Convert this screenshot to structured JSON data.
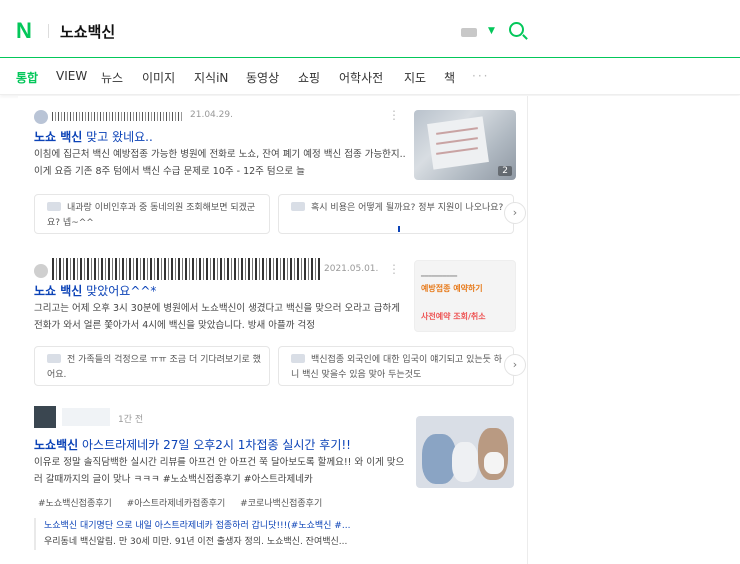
{
  "header": {
    "logo": "N",
    "query": "노쇼백신",
    "icons": [
      "keyboard-icon",
      "caret-down-icon",
      "search-icon"
    ],
    "accent": "#03c75a"
  },
  "tabs": [
    {
      "label": "통합",
      "active": true
    },
    {
      "label": "VIEW"
    },
    {
      "label": "뉴스"
    },
    {
      "label": "이미지"
    },
    {
      "label": "지식iN"
    },
    {
      "label": "동영상"
    },
    {
      "label": "쇼핑"
    },
    {
      "label": "어학사전"
    },
    {
      "label": "지도"
    },
    {
      "label": "책"
    },
    {
      "label": "···"
    }
  ],
  "results": [
    {
      "date": "21.04.29.",
      "title_bold": "노쇼 백신",
      "title_rest": " 맞고 왔네요..",
      "desc": "이침에 집근처 백신 예방접종 가능한 병원에 전화로 노쇼, 잔여 폐기 예정 백신 접종 가능한지.. 이게 요즘 기존 8주 텀에서 백신 수급 문제로 10주 - 12주 텀으로 늘",
      "thumb_count": "2",
      "subs": [
        "내과랑 이비인후과 중 동네의원 조회해보면 되겠군요? 넵~^^",
        "혹시 비용은 어떻게 될까요? 정부 지원이 나오나요?"
      ]
    },
    {
      "date": "2021.05.01.",
      "title_bold": "노쇼 백신",
      "title_rest": " 맞았어요^^*",
      "desc": "그리고는 어제 오후 3시 30분에 병원에서 노쇼백신이 생겼다고 백신을 맞으러 오라고 급하게 전화가 와서 얼른 쫓아가서 4시에 백신을 맞았습니다. 방새 아플까 걱정",
      "thumb_text_a": "예방접종 예약하기",
      "thumb_text_b": "사전예약 조회/취소",
      "subs": [
        "전 가족들의 걱정으로 ㅠㅠ 조금 더 기다려보기로 했어요.",
        "백신접종 외국인에 대한 입국이 얘기되고 있는듯 하니 백신 맞을수 있음 맞아 두는것도"
      ]
    },
    {
      "time": "1간 전",
      "title_bold": "노쇼백신",
      "title_rest": " 아스트라제네카 27일 오후2시 1차접종 실시간 후기!!",
      "desc": "이유로 정말 솔직담백한 실시간 리뷰를 아프건 안 아프건 쭉 달아보도록 할께요!! 와 이게 맞으러 갈때까지의 글이 맞나 ㅋㅋㅋ #노쇼백신접종후기 #아스트라제네카",
      "tags": [
        "#노쇼백신접종후기",
        "#아스트라제네카접종후기",
        "#코로나백신접종후기"
      ],
      "excerpts": [
        {
          "blue": "노쇼백신 대기명단 으로 내일 아스트라제네카 접종하러 갑니닷!!!(#노쇼백신 #...",
          "gray": ""
        },
        {
          "blue": "",
          "gray": "우리동네 백신알림. 만 30세 미만. 91년 이전 출생자 정의. 노쇼백신. 잔여백신..."
        }
      ]
    }
  ]
}
